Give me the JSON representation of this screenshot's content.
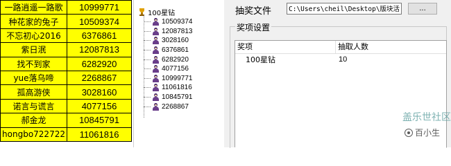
{
  "sheet": {
    "rows": [
      {
        "name": "一路逍遥一路歌",
        "value": "10999771"
      },
      {
        "name": "种花家的兔子",
        "value": "10509374"
      },
      {
        "name": "不忘初心2016",
        "value": "6376861"
      },
      {
        "name": "紫日泯",
        "value": "12087813"
      },
      {
        "name": "找不到家",
        "value": "6282920"
      },
      {
        "name": "yue落乌啼",
        "value": "2268867"
      },
      {
        "name": "孤高游侠",
        "value": "3028160"
      },
      {
        "name": "诺言与谎言",
        "value": "4077156"
      },
      {
        "name": "郝金龙",
        "value": "10845791"
      },
      {
        "name": "hongbo722722",
        "value": "11061816"
      }
    ]
  },
  "tree": {
    "root_label": "100星钻",
    "items": [
      "10509374",
      "12087813",
      "3028160",
      "6376861",
      "6282920",
      "4077156",
      "10999771",
      "11061816",
      "10845791",
      "2268867"
    ]
  },
  "panel": {
    "file_label": "抽奖文件",
    "file_path": "C:\\Users\\cheil\\Desktop\\版块活",
    "browse_label": "...",
    "group_title": "奖项设置",
    "columns": [
      "奖项",
      "抽取人数"
    ],
    "rows": [
      {
        "prize": "100星钻",
        "count": "10"
      }
    ]
  },
  "watermark": {
    "site": "盖乐世社区",
    "author": "百小生"
  }
}
